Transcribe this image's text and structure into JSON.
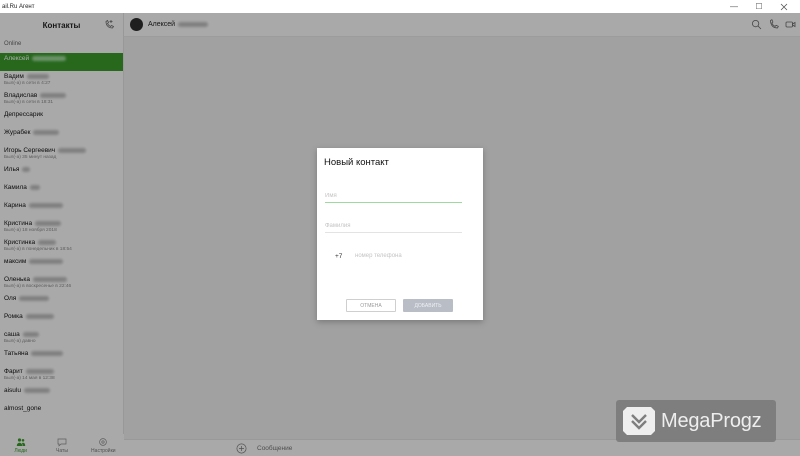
{
  "window": {
    "title": "ail.Ru Агент",
    "minimize": "—",
    "maximize": "☐"
  },
  "sidebar": {
    "title": "Контакты",
    "section": "Online",
    "contacts": [
      {
        "name": "Алексей",
        "status": "",
        "active": true
      },
      {
        "name": "Вадим",
        "status": "Был(-а) в сети в 4:27"
      },
      {
        "name": "Владислав",
        "status": "Был(-а) в сети в 18:31"
      },
      {
        "name": "Депрессарик",
        "status": ""
      },
      {
        "name": "Журабек",
        "status": ""
      },
      {
        "name": "Игорь Сергеевич",
        "status": "Был(-а) 35 минут назад"
      },
      {
        "name": "Илья",
        "status": ""
      },
      {
        "name": "Камила",
        "status": ""
      },
      {
        "name": "Карина",
        "status": ""
      },
      {
        "name": "Кристина",
        "status": "Был(-а) 18 ноября 2018"
      },
      {
        "name": "Кристинка",
        "status": "Был(-а) в понедельник в 18:54"
      },
      {
        "name": "максим",
        "status": ""
      },
      {
        "name": "Оленька",
        "status": "Был(-а) в воскресенье в 22:46"
      },
      {
        "name": "Оля",
        "status": ""
      },
      {
        "name": "Ромка",
        "status": ""
      },
      {
        "name": "саша",
        "status": "Был(-а) давно"
      },
      {
        "name": "Татьяна",
        "status": ""
      },
      {
        "name": "Фарит",
        "status": "Был(-а) 14 мая в 12:38"
      },
      {
        "name": "aisulu",
        "status": ""
      },
      {
        "name": "almost_gone",
        "status": ""
      }
    ],
    "nav": [
      {
        "label": "Люди",
        "icon": "people-icon",
        "active": true
      },
      {
        "label": "Чаты",
        "icon": "chat-icon"
      },
      {
        "label": "Настройки",
        "icon": "settings-icon"
      }
    ]
  },
  "chat": {
    "contact_name": "Алексей",
    "composer_placeholder": "Сообщение"
  },
  "modal": {
    "title": "Новый контакт",
    "first_name_placeholder": "Имя",
    "last_name_placeholder": "Фамилия",
    "phone_prefix": "+7",
    "phone_placeholder": "номер телефона",
    "cancel_label": "ОТМЕНА",
    "add_label": "ДОБАВИТЬ"
  },
  "watermark": {
    "text": "MegaProgz"
  },
  "colors": {
    "accent": "#3a9a2c",
    "focus_line": "#9fd99f",
    "disabled_button": "#b9bdc6"
  }
}
